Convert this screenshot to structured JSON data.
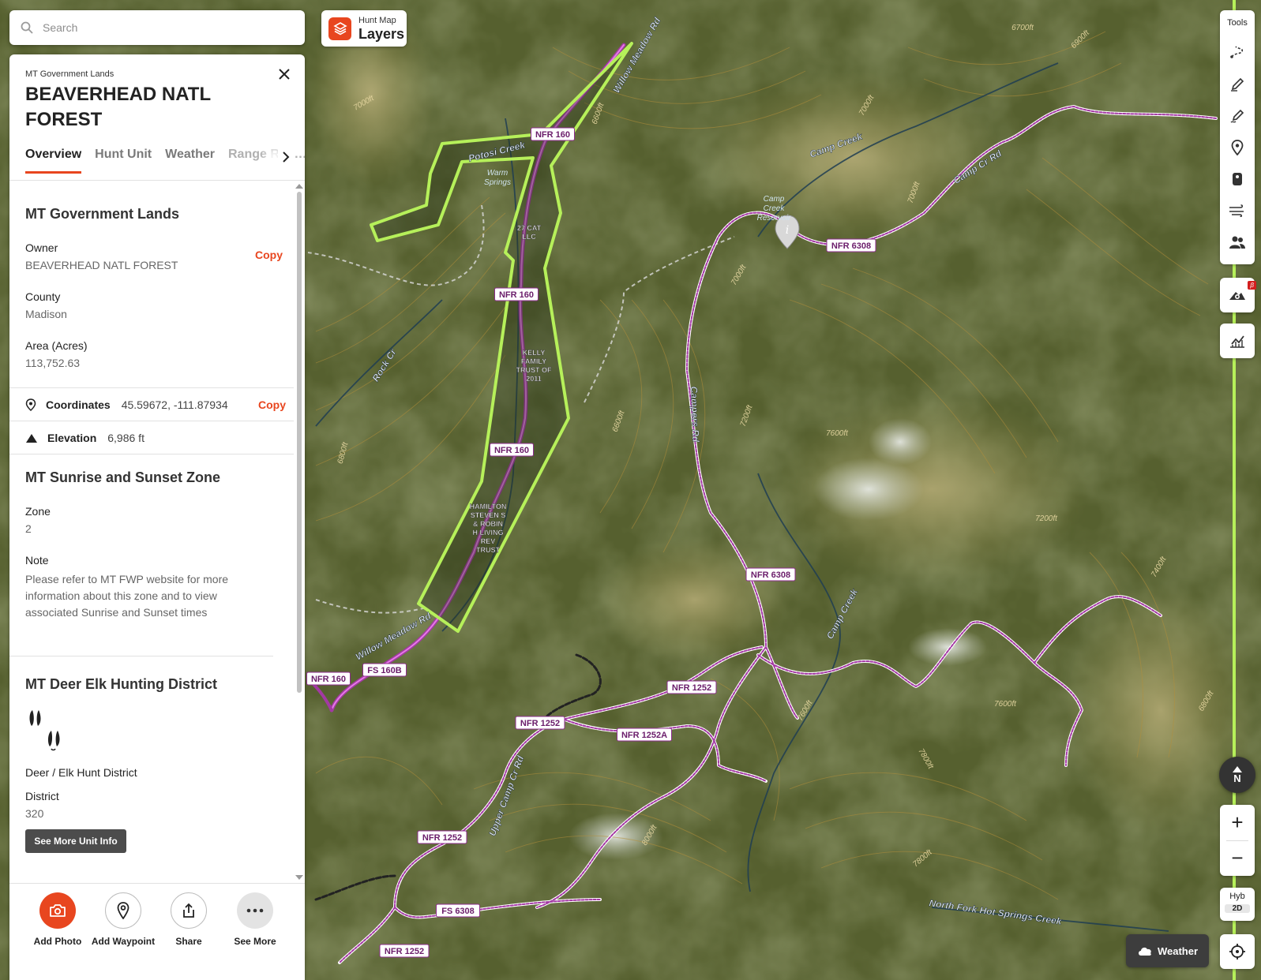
{
  "search": {
    "placeholder": "Search",
    "icon": "search-icon"
  },
  "layers": {
    "subtitle": "Hunt Map",
    "title": "Layers",
    "icon": "layers-icon",
    "accent": "#e8461f"
  },
  "panel": {
    "category": "MT Government Lands",
    "title": "BEAVERHEAD NATL FOREST",
    "tabs": [
      {
        "label": "Overview",
        "active": true
      },
      {
        "label": "Hunt Unit",
        "active": false
      },
      {
        "label": "Weather",
        "active": false
      },
      {
        "label": "Range Rad…",
        "active": false
      }
    ],
    "government": {
      "heading": "MT Government Lands",
      "owner_label": "Owner",
      "owner_value": "BEAVERHEAD NATL FOREST",
      "county_label": "County",
      "county_value": "Madison",
      "area_label": "Area (Acres)",
      "area_value": "113,752.63",
      "copy_label": "Copy"
    },
    "coordinates": {
      "label": "Coordinates",
      "value": "45.59672, -111.87934",
      "copy_label": "Copy"
    },
    "elevation": {
      "label": "Elevation",
      "value": "6,986 ft"
    },
    "sunrise": {
      "heading": "MT Sunrise and Sunset Zone",
      "zone_label": "Zone",
      "zone_value": "2",
      "note_label": "Note",
      "note_value": "Please refer to MT FWP website for more information about this zone and to view associated Sunrise and Sunset times"
    },
    "district": {
      "heading": "MT Deer Elk Hunting District",
      "type": "Deer / Elk Hunt District",
      "district_label": "District",
      "district_value": "320",
      "button": "See More Unit Info"
    },
    "actions": [
      {
        "label": "Add Photo",
        "icon": "camera-icon"
      },
      {
        "label": "Add Waypoint",
        "icon": "waypoint-icon"
      },
      {
        "label": "Share",
        "icon": "share-icon"
      },
      {
        "label": "See More",
        "icon": "more-icon"
      }
    ]
  },
  "tools": {
    "label": "Tools",
    "items": [
      "route-icon",
      "pencil-icon",
      "draw-line-icon",
      "pin-icon",
      "marker-icon",
      "wind-icon",
      "users-icon"
    ]
  },
  "beta_label": "β",
  "compass_label": "N",
  "zoom": {
    "in": "+",
    "out": "−"
  },
  "basemap": {
    "label": "Hyb",
    "mode": "2D"
  },
  "weather_button": "Weather",
  "map": {
    "road_labels": [
      "NFR 160",
      "NFR 160",
      "NFR 160",
      "NFR 160",
      "NFR 6308",
      "NFR 6308",
      "NFR 1252",
      "NFR 1252",
      "NFR 1252A",
      "NFR 1252",
      "NFR 1252",
      "FS 160B",
      "FS 6308"
    ],
    "parcel_labels": [
      "27 CAT LLC",
      "KELLY FAMILY TRUST OF 2011",
      "HAMILTON STEVEN S & ROBIN H LIVING REV TRUST"
    ],
    "creek_labels": [
      "Potosi Creek",
      "Camp Creek",
      "Camp Cr Rd",
      "Camp Creek",
      "North Fork Hot Springs Creek",
      "Rock Cr",
      "Willow Meadow Rd",
      "Willow Meadow Rd",
      "Campers Rd",
      "Upper Camp Cr Rd"
    ],
    "place_labels": [
      "Warm Springs",
      "Camp Creek Reservoir"
    ],
    "contour_labels": [
      "6900ft",
      "6700ft",
      "7000ft",
      "6600ft",
      "7000ft",
      "7000ft",
      "7000ft",
      "7200ft",
      "7600ft",
      "7200ft",
      "7400ft",
      "7600ft",
      "6800ft",
      "6600ft",
      "7600ft",
      "7800ft",
      "8000ft",
      "7800ft",
      "6800ft"
    ]
  }
}
